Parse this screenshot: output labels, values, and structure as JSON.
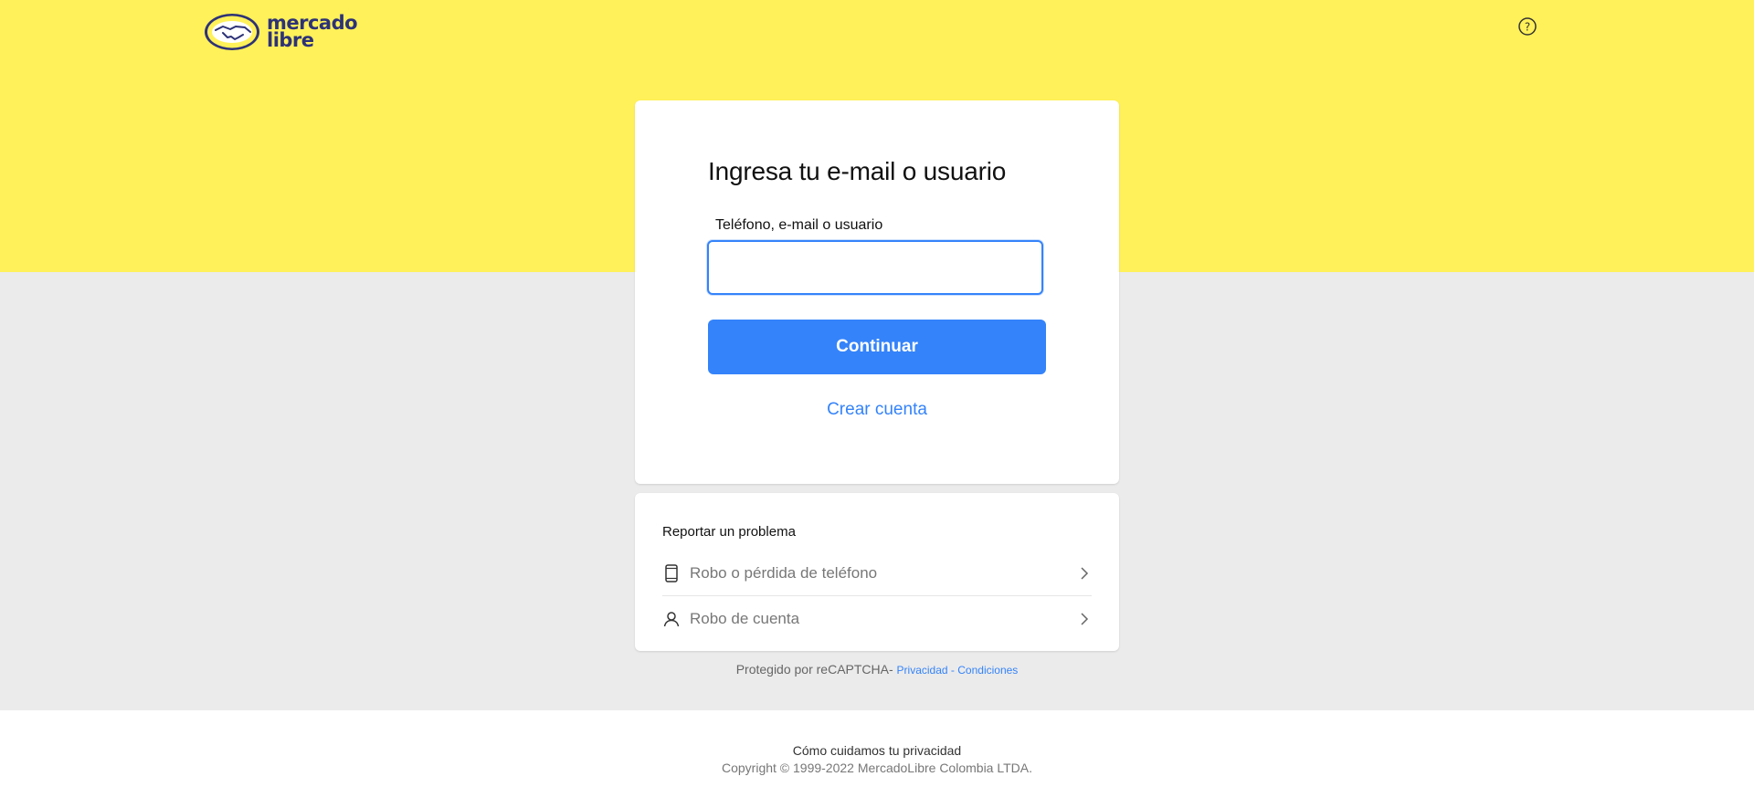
{
  "header": {
    "logo_line1": "mercado",
    "logo_line2": "libre",
    "help_icon": "question-circle-icon"
  },
  "login": {
    "title": "Ingresa tu e-mail o usuario",
    "field_label": "Teléfono, e-mail o usuario",
    "field_value": "",
    "continue_label": "Continuar",
    "create_account_label": "Crear cuenta"
  },
  "problems": {
    "title": "Reportar un problema",
    "items": [
      {
        "label": "Robo o pérdida de teléfono",
        "icon": "phone-icon"
      },
      {
        "label": "Robo de cuenta",
        "icon": "user-icon"
      }
    ]
  },
  "recaptcha": {
    "text": "Protegido por reCAPTCHA-",
    "privacy": "Privacidad",
    "separator": " - ",
    "terms": "Condiciones"
  },
  "footer": {
    "privacy_link": "Cómo cuidamos tu privacidad",
    "copyright": "Copyright © 1999-2022 MercadoLibre Colombia LTDA."
  },
  "colors": {
    "brand_yellow": "#fff159",
    "accent_blue": "#3483fa",
    "background_gray": "#ebebeb",
    "logo_navy": "#2d3277"
  }
}
